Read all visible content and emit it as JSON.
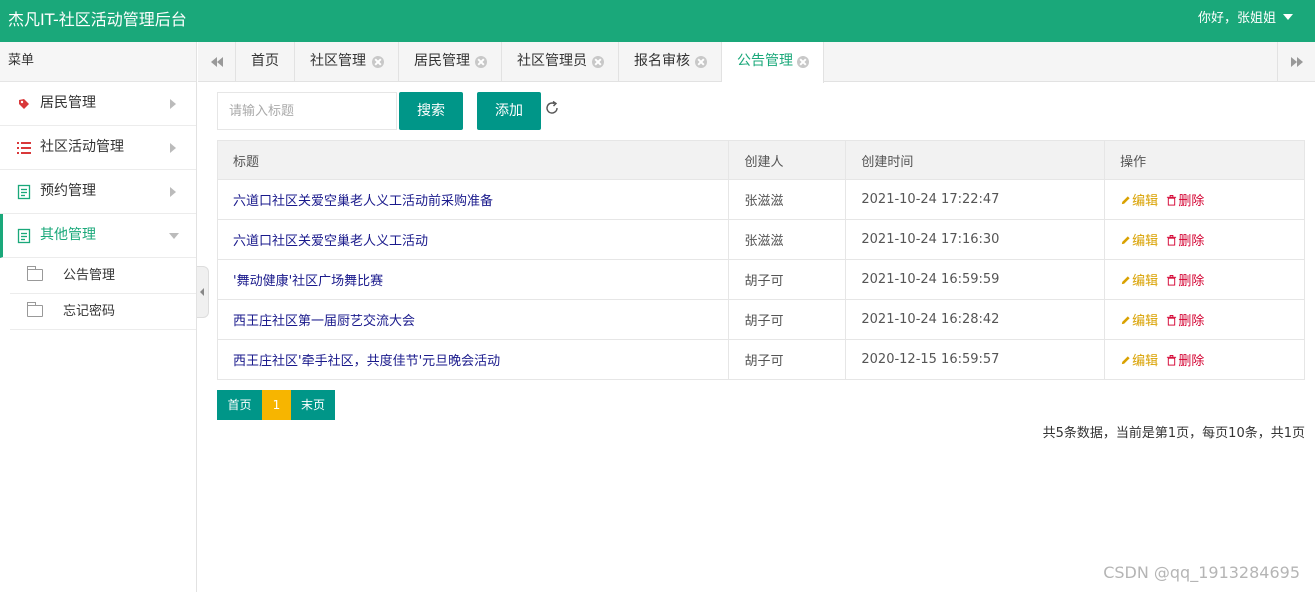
{
  "header": {
    "title": "杰凡IT-社区活动管理后台",
    "greeting": "你好，张姐姐"
  },
  "sidebar": {
    "menu_label": "菜单",
    "items": [
      {
        "label": "居民管理",
        "icon": "tag-icon",
        "expanded": false
      },
      {
        "label": "社区活动管理",
        "icon": "list-icon",
        "expanded": false
      },
      {
        "label": "预约管理",
        "icon": "form-icon",
        "expanded": false
      },
      {
        "label": "其他管理",
        "icon": "form-icon",
        "expanded": true
      }
    ],
    "subitems": [
      {
        "label": "公告管理"
      },
      {
        "label": "忘记密码"
      }
    ]
  },
  "tabs": [
    {
      "label": "首页",
      "closable": false
    },
    {
      "label": "社区管理",
      "closable": true
    },
    {
      "label": "居民管理",
      "closable": true
    },
    {
      "label": "社区管理员",
      "closable": true
    },
    {
      "label": "报名审核",
      "closable": true
    },
    {
      "label": "公告管理",
      "closable": true,
      "active": true
    }
  ],
  "toolbar": {
    "search_placeholder": "请输入标题",
    "search_value": "",
    "search_label": "搜索",
    "add_label": "添加"
  },
  "table": {
    "columns": [
      "标题",
      "创建人",
      "创建时间",
      "操作"
    ],
    "rows": [
      {
        "title": "六道口社区关爱空巢老人义工活动前采购准备",
        "creator": "张滋滋",
        "time": "2021-10-24 17:22:47"
      },
      {
        "title": "六道口社区关爱空巢老人义工活动",
        "creator": "张滋滋",
        "time": "2021-10-24 17:16:30"
      },
      {
        "title": "'舞动健康'社区广场舞比赛",
        "creator": "胡子可",
        "time": "2021-10-24 16:59:59"
      },
      {
        "title": "西王庄社区第一届厨艺交流大会",
        "creator": "胡子可",
        "time": "2021-10-24 16:28:42"
      },
      {
        "title": "西王庄社区'牵手社区，共度佳节'元旦晚会活动",
        "creator": "胡子可",
        "time": "2020-12-15 16:59:57"
      }
    ],
    "edit_label": "编辑",
    "delete_label": "删除"
  },
  "pagination": {
    "first_label": "首页",
    "current_page": "1",
    "last_label": "末页",
    "info": "共5条数据，当前是第1页，每页10条，共1页"
  },
  "watermark": "CSDN @qq_1913284695",
  "colors": {
    "header": "#1aa87a",
    "button": "#009688",
    "current_page": "#f7b500",
    "edit": "#d9a100",
    "delete": "#d40030"
  }
}
